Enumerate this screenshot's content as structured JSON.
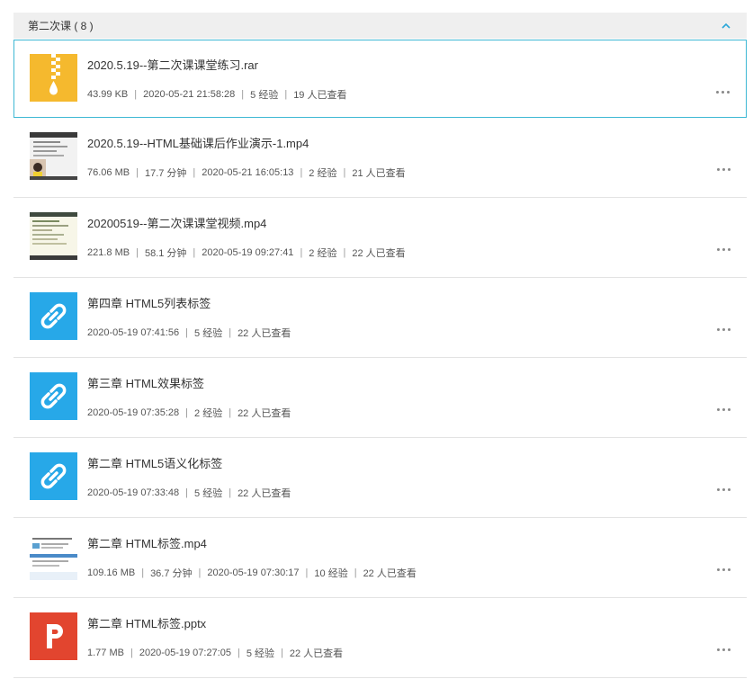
{
  "section": {
    "title": "第二次课 ( 8 )",
    "collapse_icon": "chevron-up-icon"
  },
  "colors": {
    "accent": "#3eb8d4",
    "zip": "#f5b92e",
    "link": "#27a8e8",
    "ppt": "#e2452f"
  },
  "items": [
    {
      "type": "zip",
      "icon": "zip-file-icon",
      "title": "2020.5.19--第二次课课堂练习.rar",
      "meta": [
        "43.99 KB",
        "2020-05-21 21:58:28",
        "5 经验",
        "19 人已查看"
      ]
    },
    {
      "type": "video",
      "icon": "video-thumbnail",
      "title": "2020.5.19--HTML基础课后作业演示-1.mp4",
      "meta": [
        "76.06 MB",
        "17.7 分钟",
        "2020-05-21 16:05:13",
        "2 经验",
        "21 人已查看"
      ]
    },
    {
      "type": "video",
      "icon": "video-thumbnail",
      "title": "20200519--第二次课课堂视频.mp4",
      "meta": [
        "221.8 MB",
        "58.1 分钟",
        "2020-05-19 09:27:41",
        "2 经验",
        "22 人已查看"
      ]
    },
    {
      "type": "link",
      "icon": "link-icon",
      "title": "第四章 HTML5列表标签",
      "meta": [
        "2020-05-19 07:41:56",
        "5 经验",
        "22 人已查看"
      ]
    },
    {
      "type": "link",
      "icon": "link-icon",
      "title": "第三章  HTML效果标签",
      "meta": [
        "2020-05-19 07:35:28",
        "2 经验",
        "22 人已查看"
      ]
    },
    {
      "type": "link",
      "icon": "link-icon",
      "title": "第二章 HTML5语义化标签",
      "meta": [
        "2020-05-19 07:33:48",
        "5 经验",
        "22 人已查看"
      ]
    },
    {
      "type": "video",
      "icon": "video-thumbnail",
      "title": "第二章 HTML标签.mp4",
      "meta": [
        "109.16 MB",
        "36.7 分钟",
        "2020-05-19 07:30:17",
        "10 经验",
        "22 人已查看"
      ]
    },
    {
      "type": "ppt",
      "icon": "ppt-file-icon",
      "title": "第二章  HTML标签.pptx",
      "meta": [
        "1.77 MB",
        "2020-05-19 07:27:05",
        "5 经验",
        "22 人已查看"
      ]
    }
  ]
}
